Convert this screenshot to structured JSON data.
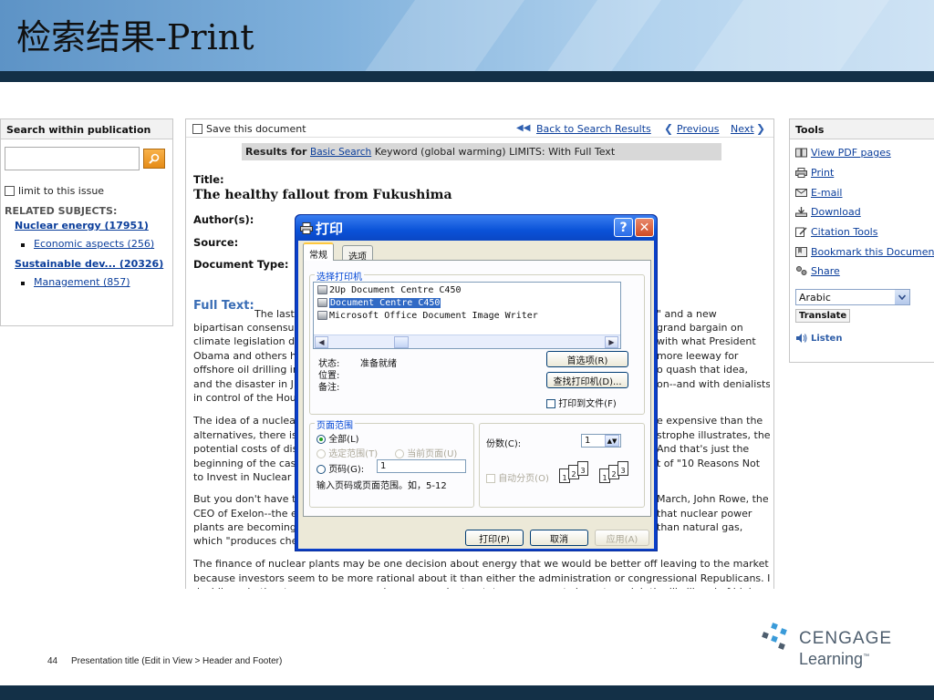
{
  "slide": {
    "title": "检索结果-Print",
    "footer_number": "44",
    "footer_text": "Presentation title (Edit in View > Header and Footer)",
    "logo_line1": "CENGAGE",
    "logo_line2": "Learning",
    "logo_tm": "™"
  },
  "colors": {
    "banner_dark": "#133047",
    "link": "#0b3e9b",
    "xp_title": "#0a52d8"
  },
  "left": {
    "header": "Search within publication",
    "limit_label": "limit to this issue",
    "related_title": "RELATED SUBJECTS:",
    "subjects": [
      {
        "label": "Nuclear energy (17951)",
        "sub": "Economic aspects (256)"
      },
      {
        "label": "Sustainable dev... (20326)",
        "sub": "Management (857)"
      }
    ]
  },
  "main": {
    "save_label": "Save this document",
    "back": "Back to Search Results",
    "previous": "Previous",
    "next": "Next",
    "results_label": "Results for",
    "results_link": "Basic Search",
    "results_query": "Keyword (global warming) LIMITS: With Full Text",
    "title_label": "Title:",
    "title_value": "The healthy fallout from Fukushima",
    "author_label": "Author(s):",
    "source_label": "Source:",
    "doctype_label": "Document Type:",
    "fulltext_label": "Full Text:",
    "lines": [
      {
        "l": "The last",
        "r": "\" and a new"
      },
      {
        "l": "bipartisan consensu",
        "r": "grand bargain on"
      },
      {
        "l": "climate legislation du",
        "r": "with what President"
      },
      {
        "l": "Obama and others h",
        "r": "more leeway for"
      },
      {
        "l": "offshore oil drilling in",
        "r": "o quash that idea,"
      },
      {
        "l": "and the disaster in J",
        "r": "on--and with denialists"
      },
      {
        "l": "in control of the Hou",
        "r": ""
      },
      {
        "l": "The idea of a nuclear",
        "r": "e expensive than the"
      },
      {
        "l": "alternatives, there is",
        "r": "strophe illustrates, the"
      },
      {
        "l": "potential costs of dis",
        "r": "And that's just the"
      },
      {
        "l": "beginning of the cas",
        "r": "t of \"10 Reasons Not"
      },
      {
        "l": "to Invest in Nuclear I",
        "r": ""
      },
      {
        "l": "But you don't have t",
        "r": "March, John Rowe, the"
      },
      {
        "l": "CEO of Exelon--the e",
        "r": "that nuclear power"
      },
      {
        "l": "plants are becoming",
        "r": "than natural gas,"
      },
      {
        "l": "which \"produces che",
        "r": ""
      },
      {
        "l": "The finance of nuclear plants may be one decision about energy that we would be better off leaving to the market",
        "r": ""
      },
      {
        "l": "because investors seem to be more rational about it than either the administration or congressional Republicans. In",
        "r": ""
      },
      {
        "l": "deciding whether to approve new nuclear power plants, state governments have to weigh the likelihood of higher",
        "r": ""
      }
    ]
  },
  "tools": {
    "header": "Tools",
    "items": [
      "View PDF pages",
      "Print",
      "E-mail",
      "Download",
      "Citation Tools",
      "Bookmark this Document",
      "Share"
    ],
    "language": "Arabic",
    "translate": "Translate",
    "listen": "Listen"
  },
  "dialog": {
    "title": "打印",
    "help": "?",
    "close": "✕",
    "tab_general": "常规",
    "tab_options": "选项",
    "group_printer": "选择打印机",
    "printers": [
      "2Up Document Centre C450",
      "Document Centre C450",
      "Microsoft Office Document Image Writer"
    ],
    "selected_printer_index": 1,
    "status_label": "状态:",
    "status_value": "准备就绪",
    "location_label": "位置:",
    "comment_label": "备注:",
    "pref_button": "首选项(R)",
    "find_button": "查找打印机(D)...",
    "print_to_file": "打印到文件(F)",
    "group_range": "页面范围",
    "all": "全部(L)",
    "selection": "选定范围(T)",
    "current_page": "当前页面(U)",
    "pages": "页码(G):",
    "pages_value": "1",
    "pages_hint": "输入页码或页面范围。如，5-12",
    "copies_label": "份数(C):",
    "copies_value": "1",
    "collate": "自动分页(O)",
    "collate_pages": [
      "1",
      "2",
      "3",
      "1",
      "2",
      "3"
    ],
    "print_button": "打印(P)",
    "cancel_button": "取消",
    "apply_button": "应用(A)"
  }
}
